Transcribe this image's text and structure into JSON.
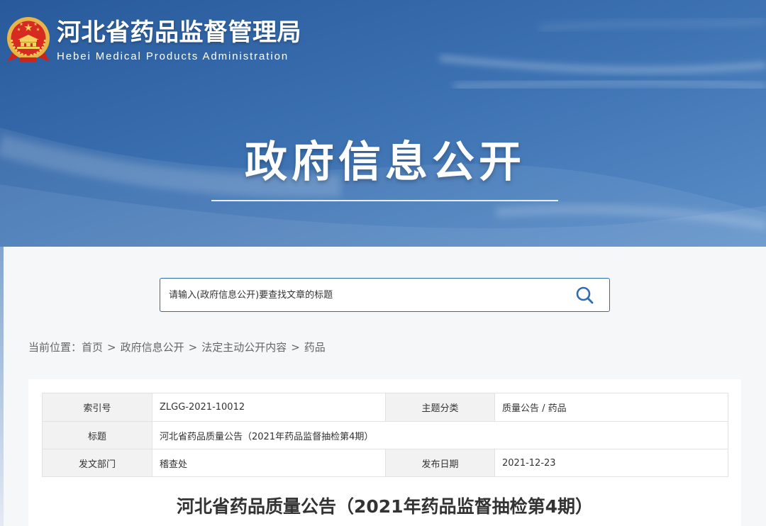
{
  "header": {
    "site_title": "河北省药品监督管理局",
    "site_subtitle": "Hebei Medical Products Administration",
    "emblem_icon": "national-emblem-icon",
    "section_title": "政府信息公开"
  },
  "search": {
    "placeholder": "请输入(政府信息公开)要查找文章的标题",
    "icon": "search-icon"
  },
  "breadcrumb": {
    "prefix": "当前位置：",
    "separator": ">",
    "items": [
      "首页",
      "政府信息公开",
      "法定主动公开内容",
      "药品"
    ]
  },
  "info_table": {
    "index_label": "索引号",
    "index_value": "ZLGG-2021-10012",
    "category_label": "主题分类",
    "category_value": "质量公告 / 药品",
    "title_label": "标题",
    "title_value": "河北省药品质量公告（2021年药品监督抽检第4期）",
    "department_label": "发文部门",
    "department_value": "稽查处",
    "date_label": "发布日期",
    "date_value": "2021-12-23"
  },
  "article": {
    "title": "河北省药品质量公告（2021年药品监督抽检第4期）"
  },
  "colors": {
    "header_blue": "#2f63a5",
    "accent_blue": "#2f6bb0",
    "label_bg": "#f2f2f2",
    "text": "#333333",
    "muted_text": "#666666"
  }
}
